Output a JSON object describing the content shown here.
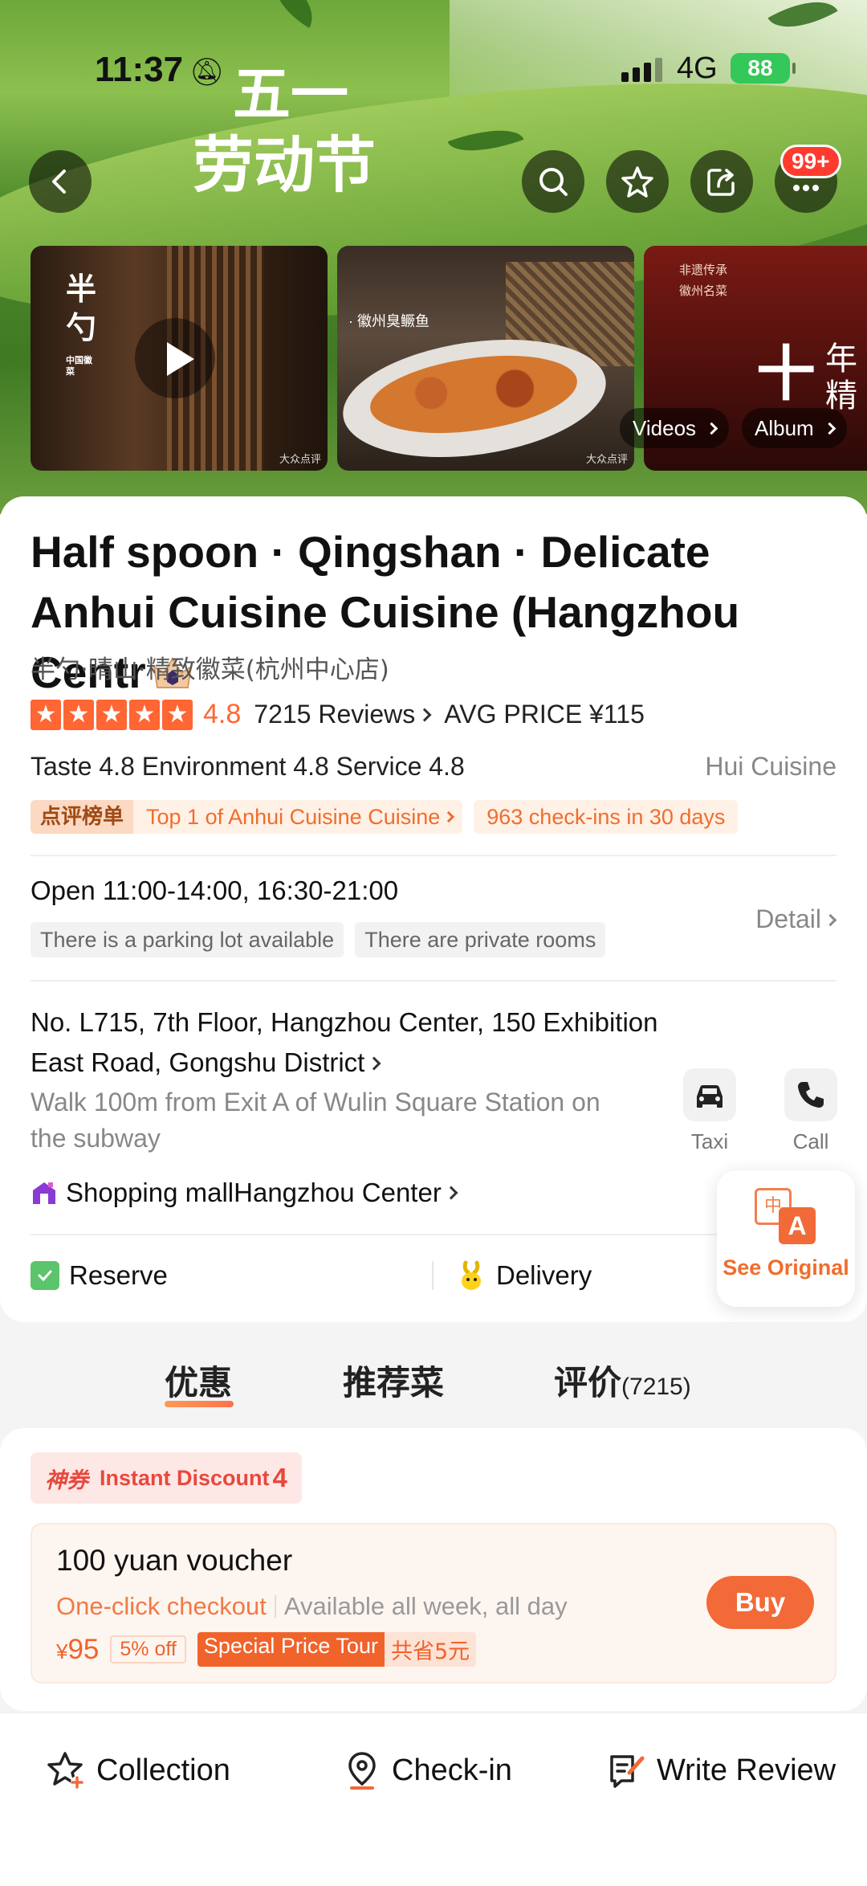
{
  "status_bar": {
    "time": "11:37",
    "network": "4G",
    "battery": "88"
  },
  "hero": {
    "festival_line1": "五一",
    "festival_line2": "劳动节",
    "notification_badge": "99+",
    "media_card1_logo": "半勺",
    "media_card1_sub": "中国徽菜",
    "media_card2_caption": "· 徽州臭鳜鱼",
    "media_card3_text": "非遗传承\n徽州名菜",
    "media_card3_big": "十",
    "media_card3_side": "年精",
    "watermark": "大众点评",
    "videos_label": "Videos",
    "album_label": "Album"
  },
  "restaurant": {
    "name": "Half spoon · Qingshan · Delicate Anhui Cuisine Cuisine (Hangzhou Centr",
    "chinese_name": "半勺·晴山·精致徽菜(杭州中心店)",
    "stars": 5,
    "score": "4.8",
    "reviews": "7215 Reviews",
    "avg_price": "AVG PRICE ¥115",
    "subscores": "Taste 4.8  Environment 4.8  Service 4.8",
    "category": "Hui Cuisine",
    "rank_badge": "点评榜单",
    "rank_text": "Top 1 of Anhui Cuisine Cuisine",
    "checkins": "963 check-ins in 30 days",
    "hours": "Open  11:00-14:00, 16:30-21:00",
    "amenities": [
      "There is a parking lot available",
      "There are private rooms"
    ],
    "detail_label": "Detail",
    "address": "No. L715, 7th Floor, Hangzhou Center, 150 Exhibition East Road, Gongshu District",
    "walk": "Walk 100m from Exit A of Wulin Square Station on the subway",
    "taxi_label": "Taxi",
    "call_label": "Call",
    "mall_prefix": "Shopping mall",
    "mall_name": "Hangzhou Center",
    "reserve_label": "Reserve",
    "delivery_label": "Delivery"
  },
  "translate": {
    "icon_a": "中",
    "icon_b": "A",
    "label": "See Original"
  },
  "tabs": [
    {
      "label": "优惠"
    },
    {
      "label": "推荐菜"
    },
    {
      "label": "评价",
      "count": "(7215)"
    }
  ],
  "deal": {
    "tag_prefix": "神券",
    "tag_text": "Instant Discount",
    "tag_count": "4",
    "voucher_title": "100 yuan voucher",
    "checkout": "One-click checkout",
    "availability": "Available all week, all day",
    "currency": "¥",
    "price": "95",
    "off": "5% off",
    "special": "Special Price Tour",
    "save": "共省5元",
    "buy_label": "Buy"
  },
  "bottom_bar": {
    "collection": "Collection",
    "checkin": "Check-in",
    "review": "Write Review"
  },
  "colors": {
    "accent": "#f26a37",
    "star": "#ff6633",
    "discount": "#e8483d"
  }
}
